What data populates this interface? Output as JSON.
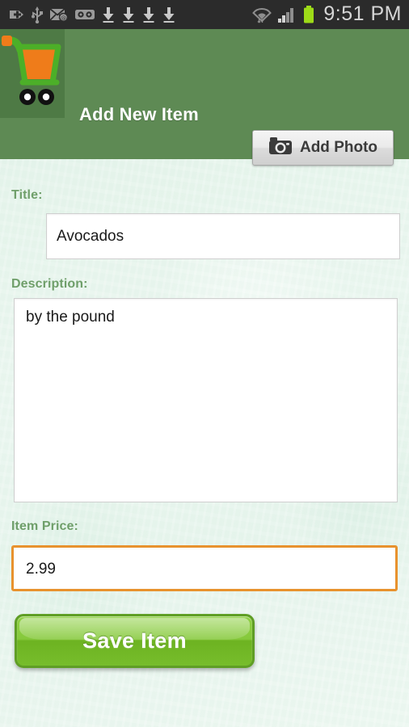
{
  "statusbar": {
    "time": "9:51 PM",
    "left_icons": [
      {
        "name": "add-badge-icon"
      },
      {
        "name": "usb-icon"
      },
      {
        "name": "email-icon"
      },
      {
        "name": "voicemail-icon"
      },
      {
        "name": "download-icon"
      },
      {
        "name": "download-icon"
      },
      {
        "name": "download-icon"
      },
      {
        "name": "download-icon"
      }
    ],
    "right_icons": [
      {
        "name": "wifi-icon"
      },
      {
        "name": "signal-bars-icon"
      },
      {
        "name": "battery-icon"
      }
    ]
  },
  "header": {
    "title": "Add New Item",
    "logo_name": "shopping-cart-logo",
    "background_color": "#5e8a54",
    "logo_tile_color": "#4e7a45"
  },
  "toolbar": {
    "add_photo_label": "Add Photo",
    "camera_icon": "camera-icon"
  },
  "form": {
    "title_label": "Title:",
    "title_value": "Avocados",
    "description_label": "Description:",
    "description_value": "by the pound",
    "price_label": "Item Price:",
    "price_value": "2.99",
    "price_focus_color": "#e8922e",
    "label_color": "#6f9f6a"
  },
  "actions": {
    "save_label": "Save Item",
    "save_color": "#77bd2c"
  }
}
